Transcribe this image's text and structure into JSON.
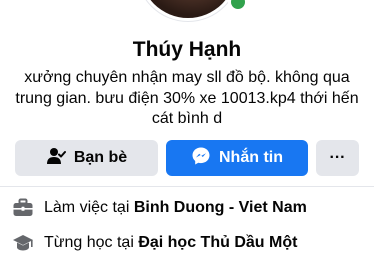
{
  "profile": {
    "name": "Thúy Hạnh",
    "bio": "xưởng chuyên nhận may sll đồ bộ. không qua\ntrung gian. bưu điện 30% xe 10013.kp4 thới hến\ncát bình d"
  },
  "actions": {
    "friends_label": "Bạn bè",
    "message_label": "Nhắn tin",
    "more_label": "···"
  },
  "info": {
    "work_prefix": "Làm việc tại ",
    "work_place": "Binh Duong - Viet Nam",
    "study_prefix": "Từng học tại ",
    "study_place": "Đại học Thủ Dầu Một"
  },
  "icons": {
    "friends": "person-check-icon",
    "message": "messenger-icon",
    "work": "briefcase-icon",
    "study": "graduation-cap-icon"
  },
  "colors": {
    "primary": "#1877f2",
    "secondary_button": "#e4e6eb",
    "online": "#31a24c"
  }
}
